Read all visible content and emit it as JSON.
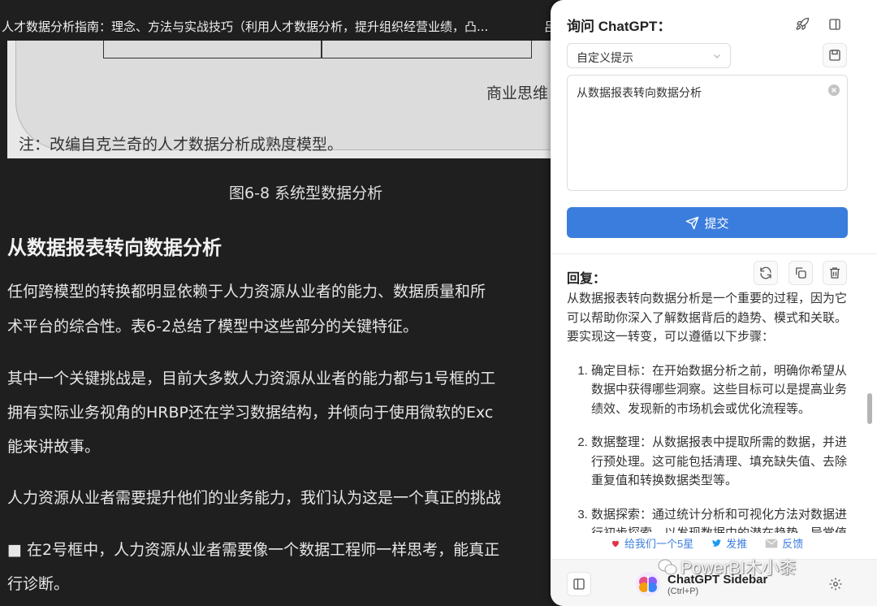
{
  "reader": {
    "title": "人才数据分析指南：理念、方法与实战技巧（利用人才数据分析，提升组织经营业绩，凸...",
    "title_right": "吕",
    "figure": {
      "side_label": "商业思维",
      "note": "注：改编自克兰奇的人才数据分析成熟度模型。"
    },
    "caption": "图6-8 系统型数据分析",
    "section_heading": "从数据报表转向数据分析",
    "paragraphs": [
      "任何跨模型的转换都明显依赖于人力资源从业者的能力、数据质量和所",
      "术平台的综合性。表6-2总结了模型中这些部分的关键特征。",
      "其中一个关键挑战是，目前大多数人力资源从业者的能力都与1号框的工",
      "拥有实际业务视角的HRBP还在学习数据结构，并倾向于使用微软的Exc",
      "能来讲故事。",
      "人力资源从业者需要提升他们的业务能力，我们认为这是一个真正的挑战",
      "■ 在2号框中，人力资源从业者需要像一个数据工程师一样思考，能真正",
      "行诊断。"
    ]
  },
  "sidebar": {
    "header_title": "询问 ChatGPT：",
    "prompt_select": "自定义提示",
    "input_value": "从数据报表转向数据分析",
    "submit_label": "提交",
    "reply_title": "回复：",
    "reply_intro": "从数据报表转向数据分析是一个重要的过程，因为它可以帮助你深入了解数据背后的趋势、模式和关联。要实现这一转变，可以遵循以下步骤：",
    "reply_steps": [
      "确定目标：在开始数据分析之前，明确你希望从数据中获得哪些洞察。这些目标可以是提高业务绩效、发现新的市场机会或优化流程等。",
      "数据整理：从数据报表中提取所需的数据，并进行预处理。这可能包括清理、填充缺失值、去除重复值和转换数据类型等。",
      "数据探索：通过统计分析和可视化方法对数据进行初步探索，以发现数据中的潜在趋势、异常值和关联。"
    ],
    "links": {
      "rate": "给我们一个5星",
      "tweet": "发推",
      "feedback": "反馈"
    },
    "footer": {
      "brand_name": "ChatGPT Sidebar",
      "shortcut": "(Ctrl+P)"
    }
  },
  "watermark": "PowerBI木小桼",
  "colors": {
    "accent": "#3b7ddd",
    "reader_bg": "#1f1f1f"
  }
}
